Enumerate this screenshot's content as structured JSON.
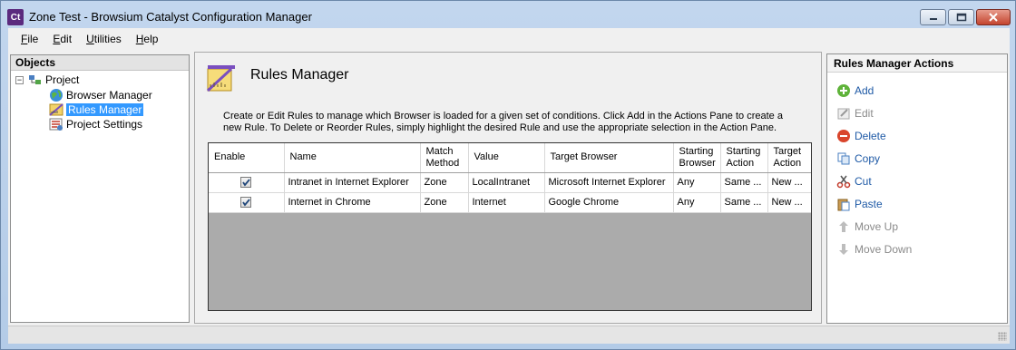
{
  "window": {
    "app_icon_text": "Ct",
    "title": "Zone Test - Browsium Catalyst Configuration Manager"
  },
  "menu": [
    {
      "underline": "F",
      "rest": "ile"
    },
    {
      "underline": "E",
      "rest": "dit"
    },
    {
      "underline": "U",
      "rest": "tilities"
    },
    {
      "underline": "H",
      "rest": "elp"
    }
  ],
  "objects_pane": {
    "header": "Objects",
    "expander": "−",
    "root": "Project",
    "children": [
      "Browser Manager",
      "Rules Manager",
      "Project Settings"
    ],
    "selected": "Rules Manager"
  },
  "rules_manager": {
    "title": "Rules Manager",
    "description": "Create or Edit Rules to manage which Browser is loaded for a given set of conditions. Click Add in the Actions Pane to create a new Rule. To Delete or Reorder Rules, simply highlight the desired Rule and use the appropriate selection in the Action Pane.",
    "columns": [
      "Enable",
      "Name",
      "Match Method",
      "Value",
      "Target Browser",
      "Starting Browser",
      "Starting Action",
      "Target Action"
    ],
    "rows": [
      {
        "enabled": true,
        "name": "Intranet in Internet Explorer",
        "match": "Zone",
        "value": "LocalIntranet",
        "target": "Microsoft Internet Explorer",
        "start_browser": "Any",
        "start_action": "Same ...",
        "target_action": "New ..."
      },
      {
        "enabled": true,
        "name": "Internet in Chrome",
        "match": "Zone",
        "value": "Internet",
        "target": "Google Chrome",
        "start_browser": "Any",
        "start_action": "Same ...",
        "target_action": "New ..."
      }
    ]
  },
  "actions_pane": {
    "header": "Rules Manager Actions",
    "add": "Add",
    "edit": "Edit",
    "delete": "Delete",
    "copy": "Copy",
    "cut": "Cut",
    "paste": "Paste",
    "move_up": "Move Up",
    "move_down": "Move Down"
  }
}
